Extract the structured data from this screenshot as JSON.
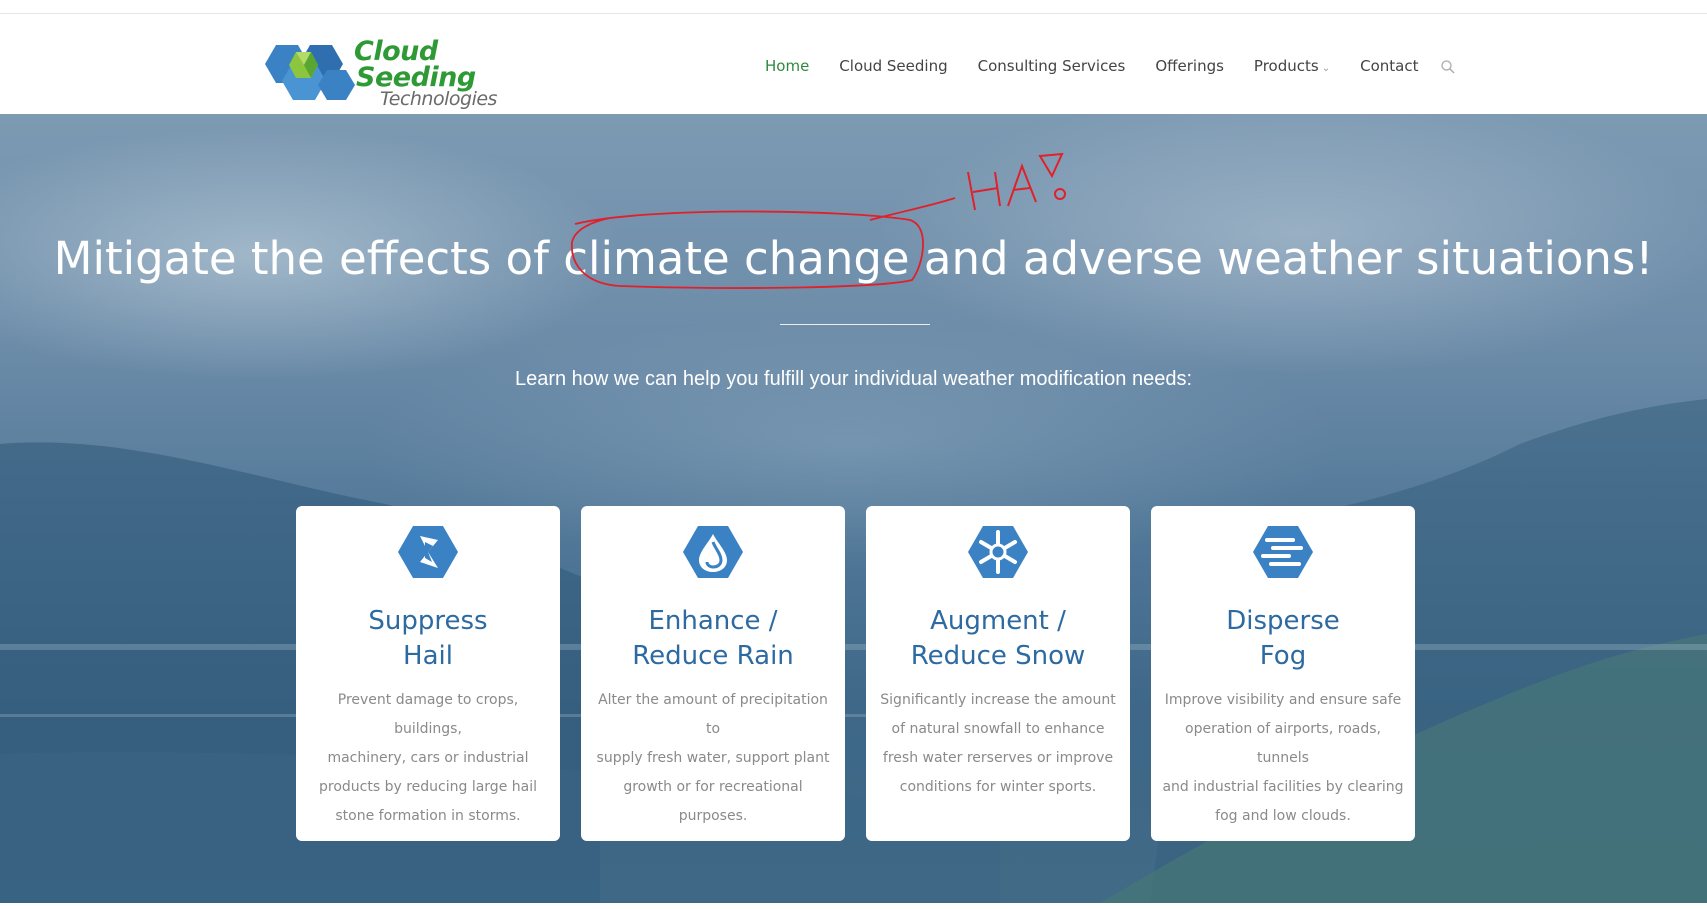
{
  "logo": {
    "word1": "Cloud",
    "word2": "Seeding",
    "word3": "Technologies",
    "color_green": "#2e9a35",
    "color_blue": "#3a82c4"
  },
  "nav": {
    "items": [
      {
        "label": "Home",
        "active": true
      },
      {
        "label": "Cloud Seeding"
      },
      {
        "label": "Consulting Services"
      },
      {
        "label": "Offerings"
      },
      {
        "label": "Products",
        "has_dropdown": true
      },
      {
        "label": "Contact"
      }
    ],
    "search_icon": "search-icon"
  },
  "hero": {
    "headline": "Mitigate the effects of climate change and adverse weather situations!",
    "subhead": "Learn how we can help you fulfill your individual weather modification needs:",
    "annotation_text": "HA!",
    "annotation_color": "#e0202a"
  },
  "cards": [
    {
      "icon": "hail-bolt-icon",
      "title_line1": "Suppress",
      "title_line2": "Hail",
      "desc_lines": [
        "Prevent damage to crops, buildings,",
        "machinery, cars or industrial",
        "products by reducing large hail",
        "stone formation in storms."
      ]
    },
    {
      "icon": "rain-drop-icon",
      "title_line1": "Enhance /",
      "title_line2": "Reduce Rain",
      "desc_lines": [
        "Alter the amount of precipitation to",
        "supply fresh water, support plant",
        "growth or for recreational",
        "purposes."
      ]
    },
    {
      "icon": "snowflake-icon",
      "title_line1": "Augment /",
      "title_line2": "Reduce Snow",
      "desc_lines": [
        "Significantly increase the amount",
        "of natural snowfall to enhance",
        "fresh water rerserves or improve",
        "conditions for winter sports."
      ]
    },
    {
      "icon": "fog-icon",
      "title_line1": "Disperse",
      "title_line2": "Fog",
      "desc_lines": [
        "Improve visibility and ensure safe",
        "operation of airports, roads, tunnels",
        "and industrial facilities by clearing",
        "fog and low clouds."
      ]
    }
  ],
  "colors": {
    "nav_active": "#2e8a3e",
    "card_title": "#2d6aa1",
    "icon_blue": "#3a82c4"
  }
}
